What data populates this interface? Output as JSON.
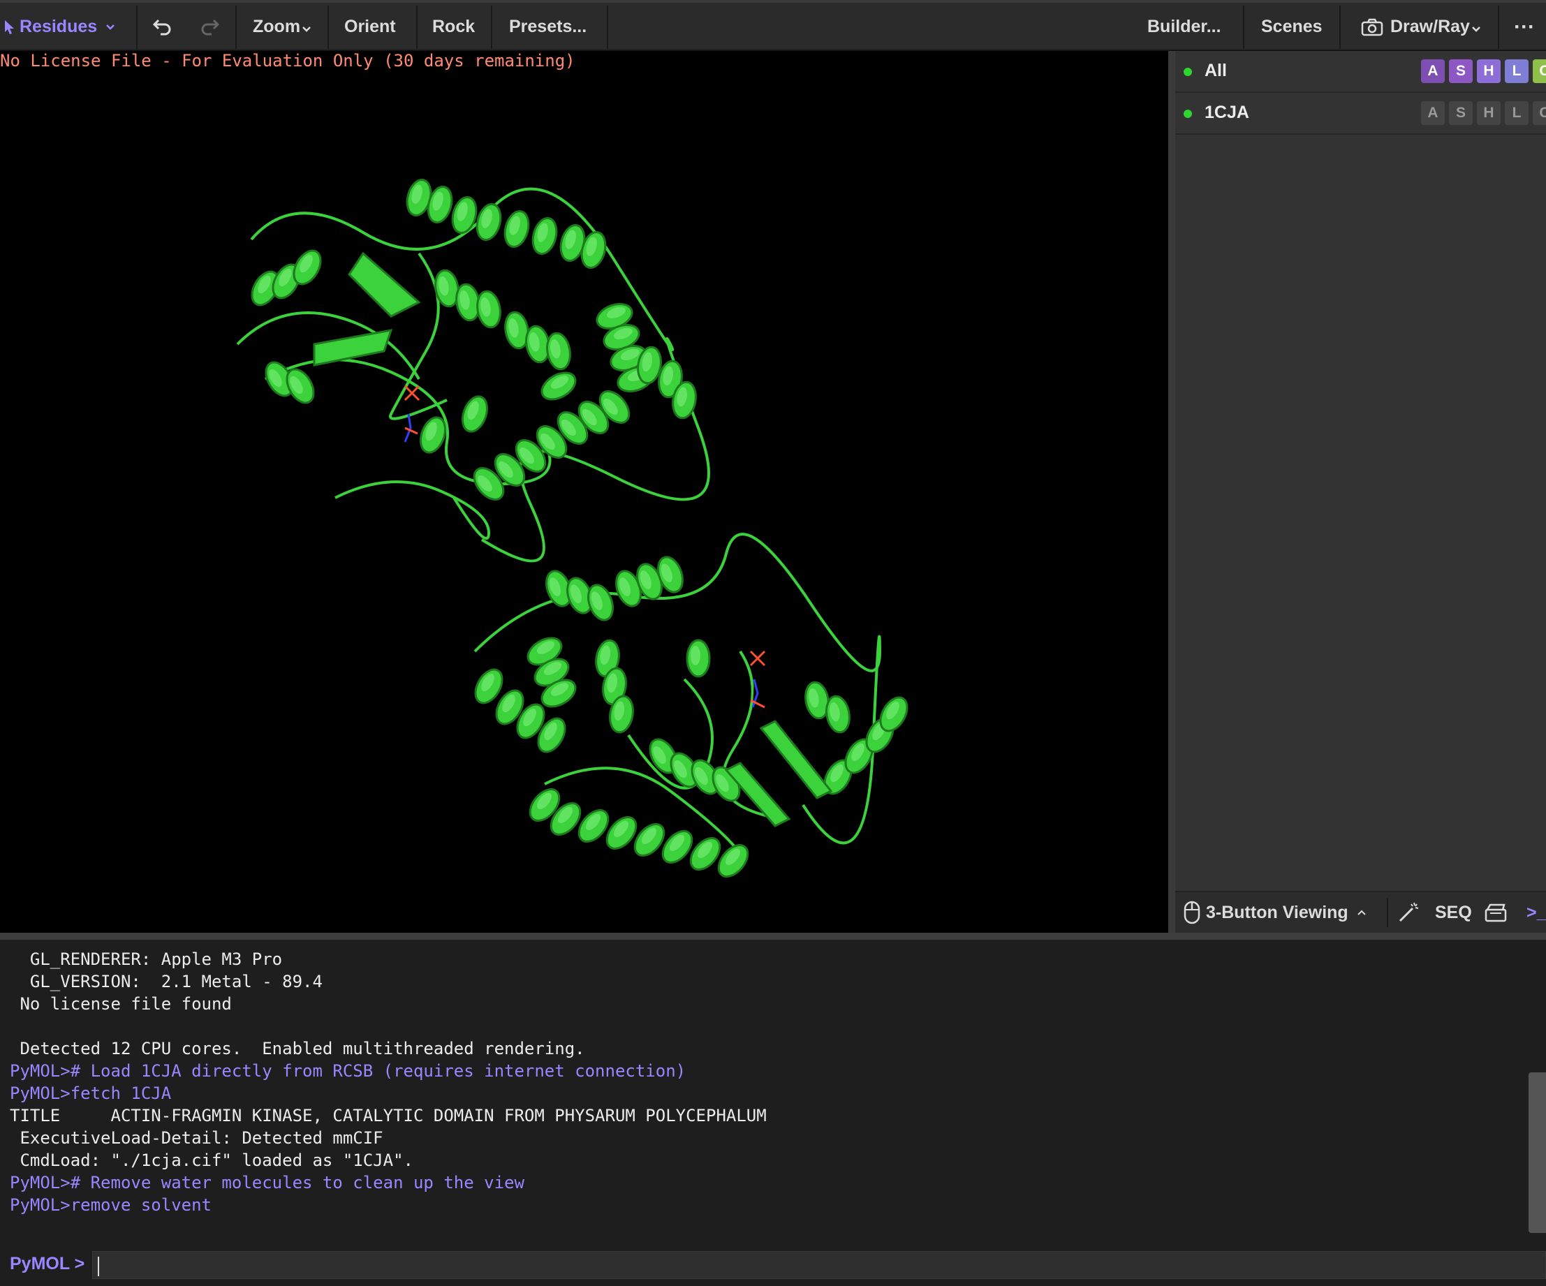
{
  "toolbar": {
    "mode_label": "Residues",
    "zoom_label": "Zoom",
    "orient_label": "Orient",
    "rock_label": "Rock",
    "presets_label": "Presets...",
    "builder_label": "Builder...",
    "scenes_label": "Scenes",
    "drawray_label": "Draw/Ray",
    "more_label": "···"
  },
  "viewer": {
    "license_text": "No License File - For Evaluation Only (30 days remaining)",
    "background": "#000000",
    "cartoon_color": "#3cd23c"
  },
  "objects": [
    {
      "name": "All",
      "badges": [
        "A",
        "S",
        "H",
        "L",
        "C"
      ],
      "badge_colors": [
        "#7d4fb3",
        "#8d58c4",
        "#8d6ed8",
        "#7e7ed6",
        "#8ec04a"
      ]
    },
    {
      "name": "1CJA",
      "badges": [
        "A",
        "S",
        "H",
        "L",
        "C"
      ]
    }
  ],
  "panel_footer": {
    "viewing_label": "3-Button Viewing",
    "seq_label": "SEQ",
    "terminal_label": ">_"
  },
  "console": {
    "lines": [
      {
        "text": "  GL_RENDERER: Apple M3 Pro",
        "type": "out"
      },
      {
        "text": "  GL_VERSION:  2.1 Metal - 89.4",
        "type": "out"
      },
      {
        "text": " No license file found",
        "type": "out"
      },
      {
        "text": "",
        "type": "out"
      },
      {
        "text": " Detected 12 CPU cores.  Enabled multithreaded rendering.",
        "type": "out"
      },
      {
        "text": "PyMOL># Load 1CJA directly from RCSB (requires internet connection)",
        "type": "cmd"
      },
      {
        "text": "PyMOL>fetch 1CJA",
        "type": "cmd"
      },
      {
        "text": "TITLE     ACTIN-FRAGMIN KINASE, CATALYTIC DOMAIN FROM PHYSARUM POLYCEPHALUM",
        "type": "out"
      },
      {
        "text": " ExecutiveLoad-Detail: Detected mmCIF",
        "type": "out"
      },
      {
        "text": " CmdLoad: \"./1cja.cif\" loaded as \"1CJA\".",
        "type": "out"
      },
      {
        "text": "PyMOL># Remove water molecules to clean up the view",
        "type": "cmd"
      },
      {
        "text": "PyMOL>remove solvent",
        "type": "cmd"
      }
    ],
    "prompt_label": "PyMOL >",
    "input_value": ""
  },
  "colors": {
    "accent": "#9a86ff",
    "license": "#ff8a73",
    "visible_dot": "#2fd62f"
  }
}
